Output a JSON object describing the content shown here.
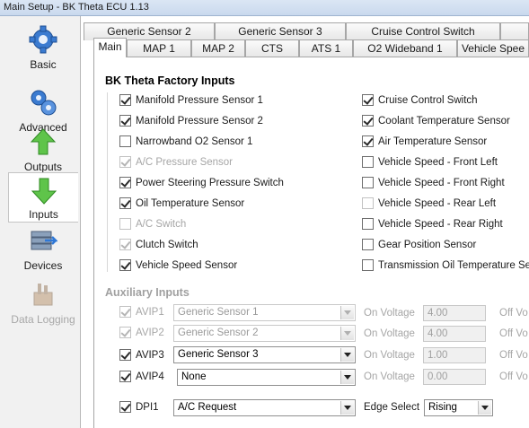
{
  "window": {
    "title": "Main Setup - BK Theta ECU 1.13"
  },
  "nav": [
    {
      "label": "Basic",
      "icon": "gear-icon"
    },
    {
      "label": "Advanced",
      "icon": "gears-icon"
    },
    {
      "label": "Outputs",
      "icon": "arrow-up-icon"
    },
    {
      "label": "Inputs",
      "icon": "arrow-down-icon"
    },
    {
      "label": "Devices",
      "icon": "devices-icon"
    },
    {
      "label": "Data Logging",
      "icon": "data-logging-icon"
    }
  ],
  "tabs_row1": [
    "Generic Sensor 2",
    "Generic Sensor 3",
    "Cruise Control Switch"
  ],
  "tabs_row2": [
    "Main",
    "MAP 1",
    "MAP 2",
    "CTS",
    "ATS 1",
    "O2 Wideband 1",
    "Vehicle Spee"
  ],
  "factory": {
    "title": "BK Theta Factory Inputs",
    "left": [
      {
        "label": "Manifold Pressure Sensor 1",
        "checked": true,
        "enabled": true
      },
      {
        "label": "Manifold Pressure Sensor 2",
        "checked": true,
        "enabled": true
      },
      {
        "label": "Narrowband O2 Sensor 1",
        "checked": false,
        "enabled": true
      },
      {
        "label": "A/C Pressure Sensor",
        "checked": true,
        "enabled": false
      },
      {
        "label": "Power Steering Pressure Switch",
        "checked": true,
        "enabled": true
      },
      {
        "label": "Oil Temperature Sensor",
        "checked": true,
        "enabled": true
      },
      {
        "label": "A/C Switch",
        "checked": false,
        "enabled": false
      },
      {
        "label": "Clutch Switch",
        "checked": true,
        "enabled": false
      },
      {
        "label": "Vehicle Speed Sensor",
        "checked": true,
        "enabled": true
      }
    ],
    "right": [
      {
        "label": "Cruise Control Switch",
        "checked": true,
        "enabled": true
      },
      {
        "label": "Coolant Temperature Sensor",
        "checked": true,
        "enabled": true
      },
      {
        "label": "Air Temperature Sensor",
        "checked": true,
        "enabled": true
      },
      {
        "label": "Vehicle Speed - Front Left",
        "checked": false,
        "enabled": true
      },
      {
        "label": "Vehicle Speed - Front Right",
        "checked": false,
        "enabled": true
      },
      {
        "label": "Vehicle Speed - Rear Left",
        "checked": false,
        "enabled": false
      },
      {
        "label": "Vehicle Speed - Rear Right",
        "checked": false,
        "enabled": true
      },
      {
        "label": "Gear Position Sensor",
        "checked": false,
        "enabled": true
      },
      {
        "label": "Transmission Oil Temperature Sens",
        "checked": false,
        "enabled": true
      }
    ]
  },
  "aux": {
    "title": "Auxiliary Inputs",
    "on_voltage_label": "On Voltage",
    "off_voltage_label": "Off Vo",
    "rows": [
      {
        "name": "AVIP1",
        "checked": true,
        "enabled": false,
        "sensor": "Generic Sensor 1",
        "on_voltage": "4.00"
      },
      {
        "name": "AVIP2",
        "checked": true,
        "enabled": false,
        "sensor": "Generic Sensor 2",
        "on_voltage": "4.00"
      },
      {
        "name": "AVIP3",
        "checked": true,
        "enabled": true,
        "sensor": "Generic Sensor 3",
        "on_voltage": "1.00"
      },
      {
        "name": "AVIP4",
        "checked": true,
        "enabled": true,
        "sensor": "None",
        "on_voltage": "0.00"
      }
    ],
    "dpi": {
      "name": "DPI1",
      "checked": true,
      "function": "A/C Request",
      "edge_label": "Edge Select",
      "edge": "Rising"
    }
  }
}
